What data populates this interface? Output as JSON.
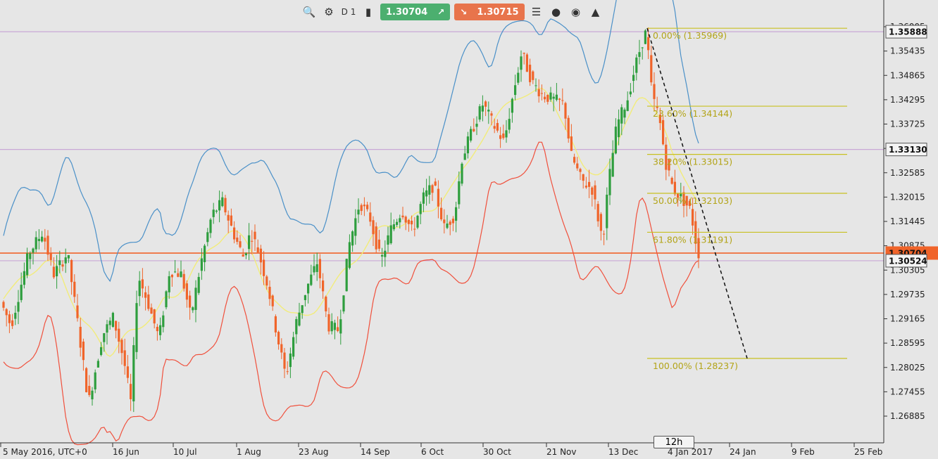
{
  "toolbar": {
    "icons": [
      "zoom-icon",
      "chart-settings-icon",
      "timeframe-icon",
      "candles-icon",
      "list-icon",
      "facebook-icon",
      "community-icon",
      "user-icon"
    ],
    "timeframe": "D 1",
    "buy_price": "1.30704",
    "buy_arrow": "↗",
    "sell_price": "1.30715",
    "sell_arrow": "↘",
    "buy_color": "#4caf6f",
    "sell_color": "#e8744c"
  },
  "timeframe_box": "12h",
  "chart_data": {
    "type": "candlestick",
    "x_ticks": [
      "5 May 2016, UTC+0",
      "16 Jun",
      "10 Jul",
      "1 Aug",
      "23 Aug",
      "14 Sep",
      "6 Oct",
      "30 Oct",
      "21 Nov",
      "13 Dec",
      "4 Jan 2017",
      "24 Jan",
      "9 Feb",
      "25 Feb"
    ],
    "y_ticks": [
      "1.36005",
      "1.35435",
      "1.34865",
      "1.34295",
      "1.33725",
      "1.33155",
      "1.32585",
      "1.32015",
      "1.31445",
      "1.30875",
      "1.30305",
      "1.29735",
      "1.29165",
      "1.28595",
      "1.28025",
      "1.27455",
      "1.26885"
    ],
    "ylim": [
      1.2646,
      1.362
    ],
    "price_tags": [
      {
        "label": "1.35888",
        "value": 1.35888,
        "color": "#c9a8d6"
      },
      {
        "label": "1.33130",
        "value": 1.3313,
        "color": "#c9a8d6"
      },
      {
        "label": "1.30704",
        "value": 1.30704,
        "color": "#f0642a"
      },
      {
        "label": "1.30524",
        "value": 1.30524,
        "color": "#c9a8d6"
      }
    ],
    "fibonacci": [
      {
        "label": "0.00% (1.35969)",
        "value": 1.35969
      },
      {
        "label": "23.60% (1.34144)",
        "value": 1.34144
      },
      {
        "label": "38.20% (1.33015)",
        "value": 1.33015
      },
      {
        "label": "50.00% (1.32103)",
        "value": 1.32103
      },
      {
        "label": "61.80% (1.31191)",
        "value": 1.31191
      },
      {
        "label": "100.00% (1.28237)",
        "value": 1.28237
      }
    ],
    "trendline": {
      "from": [
        1.35969
      ],
      "to": [
        1.28237
      ],
      "style": "dashed"
    },
    "colors": {
      "up": "#2e9e3e",
      "down": "#f0642a",
      "upper_band": "#4a90c8",
      "middle_band": "#f2ec7a",
      "lower_band": "#f0503c",
      "fib": "#c8c020"
    }
  }
}
